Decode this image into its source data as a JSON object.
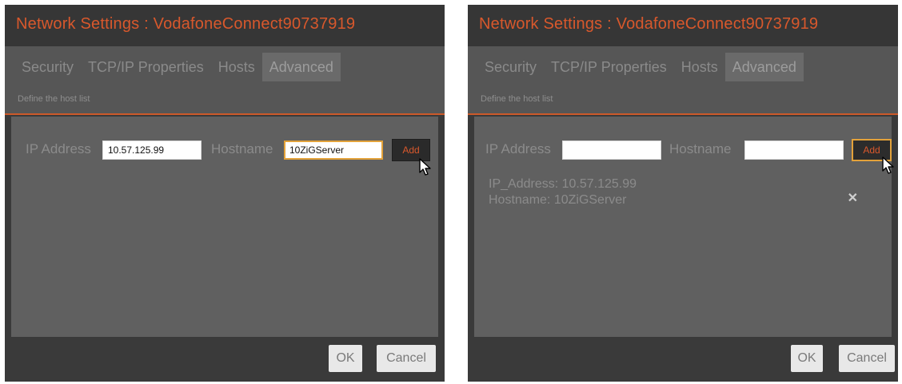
{
  "dialogs": [
    {
      "title": "Network Settings : VodafoneConnect90737919",
      "tabs": [
        {
          "label": "Security"
        },
        {
          "label": "TCP/IP Properties"
        },
        {
          "label": "Hosts"
        },
        {
          "label": "Advanced"
        }
      ],
      "active_tab": "Advanced",
      "subtitle": "Define the host list",
      "ip_label": "IP Address",
      "ip_value": "10.57.125.99",
      "hostname_label": "Hostname",
      "hostname_value": "10ZiGServer",
      "add_label": "Add",
      "ok_label": "OK",
      "cancel_label": "Cancel"
    },
    {
      "title": "Network Settings : VodafoneConnect90737919",
      "tabs": [
        {
          "label": "Security"
        },
        {
          "label": "TCP/IP Properties"
        },
        {
          "label": "Hosts"
        },
        {
          "label": "Advanced"
        }
      ],
      "active_tab": "Advanced",
      "subtitle": "Define the host list",
      "ip_label": "IP Address",
      "ip_value": "",
      "hostname_label": "Hostname",
      "hostname_value": "",
      "add_label": "Add",
      "host_entries": [
        {
          "ip_text": "IP_Address: 10.57.125.99",
          "hostname_text": "Hostname: 10ZiGServer"
        }
      ],
      "ok_label": "OK",
      "cancel_label": "Cancel"
    }
  ],
  "colors": {
    "accent": "#d8582c",
    "focus_border": "#e3a23a",
    "dialog_bg": "#3a3a3a",
    "content_bg": "#606060"
  },
  "icons": {
    "delete": "close-icon",
    "cursor": "mouse-pointer-icon"
  }
}
